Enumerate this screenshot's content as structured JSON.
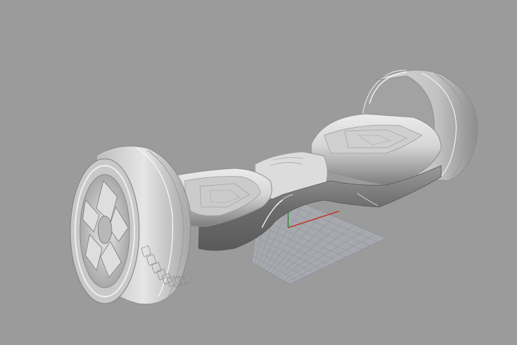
{
  "viewport": {
    "background_color": "#9b9b9b",
    "model_color": "#d9d9d9",
    "grid_color": "#8a8f9a",
    "grid_bg_color": "#a4a6ab",
    "axis_x_color": "#c0392b",
    "axis_y_color": "#2e8b3a",
    "object": "hoverboard-3d-model"
  }
}
